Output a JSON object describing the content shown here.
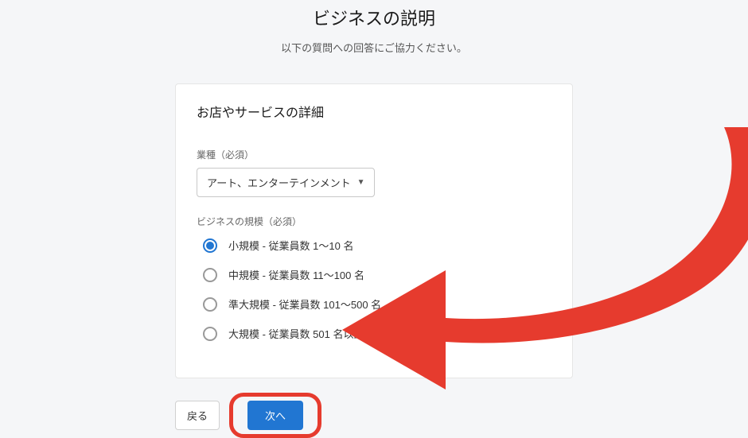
{
  "header": {
    "title": "ビジネスの説明",
    "subtitle": "以下の質問への回答にご協力ください。"
  },
  "card": {
    "title": "お店やサービスの詳細",
    "industry": {
      "label": "業種（必須）",
      "selected": "アート、エンターテインメント"
    },
    "scale": {
      "label": "ビジネスの規模（必須）",
      "options": [
        {
          "label": "小規模 - 従業員数 1〜10 名",
          "selected": true
        },
        {
          "label": "中規模 - 従業員数 11〜100 名",
          "selected": false
        },
        {
          "label": "準大規模 - 従業員数 101〜500 名",
          "selected": false
        },
        {
          "label": "大規模 - 従業員数 501 名以上",
          "selected": false
        }
      ]
    }
  },
  "buttons": {
    "back": "戻る",
    "next": "次へ"
  },
  "annotation": {
    "type": "arrow",
    "color": "#e63b2e",
    "points_to": "next-button"
  }
}
